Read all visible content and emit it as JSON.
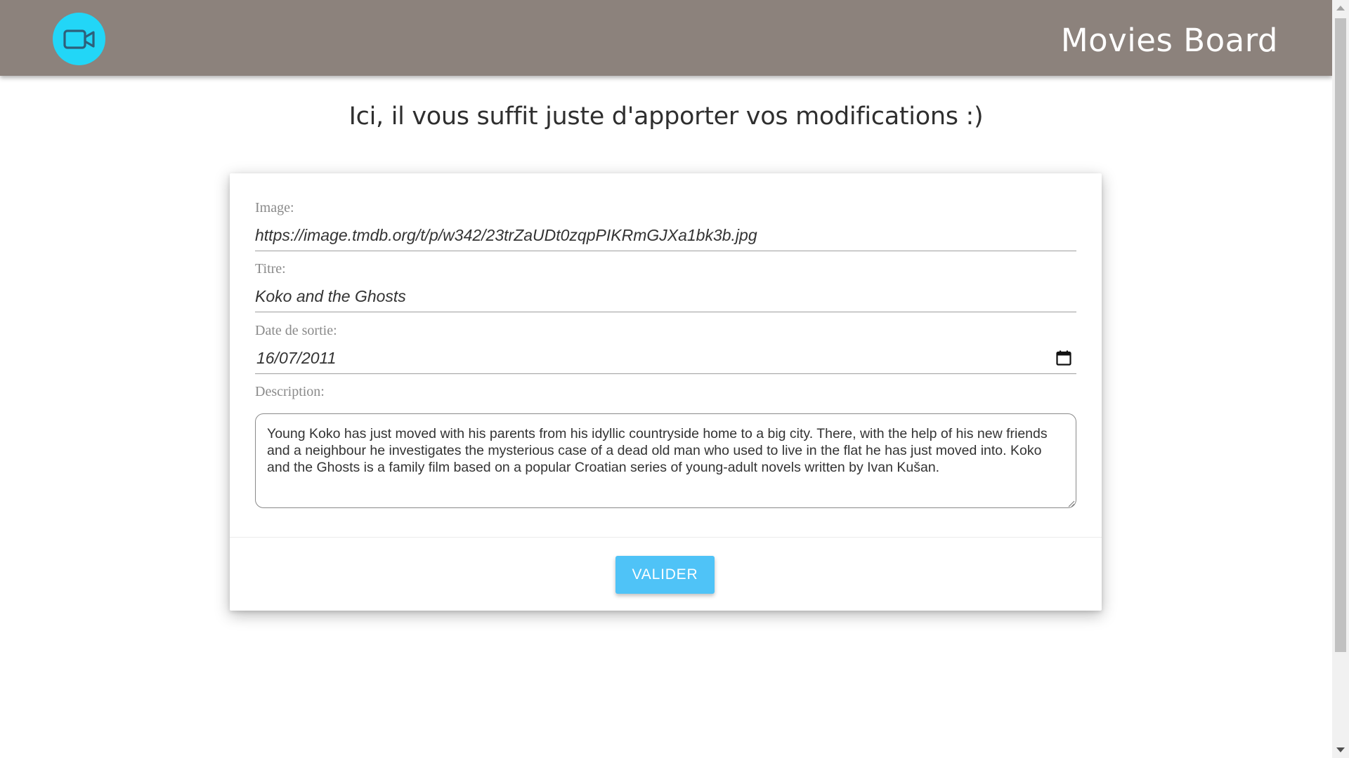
{
  "header": {
    "title": "Movies Board",
    "logo_icon": "video-camera-icon",
    "background_color": "#8c827c",
    "logo_color": "#22d6f7"
  },
  "page": {
    "heading": "Ici, il vous suffit juste d'apporter vos modifications :)"
  },
  "form": {
    "image": {
      "label": "Image:",
      "value": "https://image.tmdb.org/t/p/w342/23trZaUDt0zqpPIKRmGJXa1bk3b.jpg"
    },
    "title": {
      "label": "Titre:",
      "value": "Koko and the Ghosts"
    },
    "release_date": {
      "label": "Date de sortie:",
      "value": "16/07/2011",
      "icon": "calendar-icon"
    },
    "description": {
      "label": "Description:",
      "value": "Young Koko has just moved with his parents from his idyllic countryside home to a big city. There, with the help of his new friends and a neighbour he investigates the mysterious case of a dead old man who used to live in the flat he has just moved into. Koko and the Ghosts is a family film based on a popular Croatian series of young-adult novels written by Ivan Kušan."
    },
    "submit_label": "VALIDER",
    "submit_color": "#4fc3f7"
  }
}
